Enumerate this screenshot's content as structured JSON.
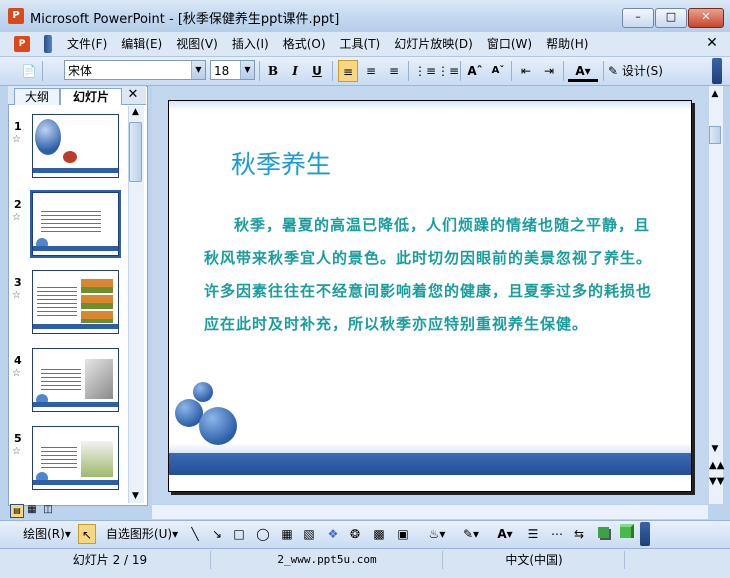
{
  "window": {
    "title": "Microsoft PowerPoint - [秋季保健养生ppt课件.ppt]",
    "app_icon": "P"
  },
  "menu": {
    "items": [
      "文件(F)",
      "编辑(E)",
      "视图(V)",
      "插入(I)",
      "格式(O)",
      "工具(T)",
      "幻灯片放映(D)",
      "窗口(W)",
      "帮助(H)"
    ]
  },
  "toolbar": {
    "font_name": "宋体",
    "font_size": "18",
    "bold": "B",
    "italic": "I",
    "underline": "U",
    "design_label": "设计(S)"
  },
  "panel": {
    "tab_outline": "大纲",
    "tab_slides": "幻灯片",
    "thumbs": [
      {
        "num": "1"
      },
      {
        "num": "2"
      },
      {
        "num": "3"
      },
      {
        "num": "4"
      },
      {
        "num": "5"
      }
    ]
  },
  "slide": {
    "title": "秋季养生",
    "body": "秋季，暑夏的高温已降低，人们烦躁的情绪也随之平静，且秋风带来秋季宜人的景色。此时切勿因眼前的美景忽视了养生。许多因素往往在不经意间影响着您的健康，且夏季过多的耗损也应在此时及时补充，所以秋季亦应特别重视养生保健。"
  },
  "drawbar": {
    "draw_label": "绘图(R)",
    "autoshape_label": "自选图形(U)"
  },
  "status": {
    "slide_pos": "幻灯片 2 / 19",
    "template": "2_www.ppt5u.com",
    "language": "中文(中国)"
  }
}
